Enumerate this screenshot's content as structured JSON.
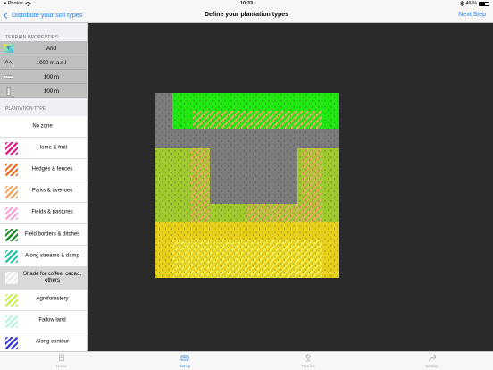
{
  "status": {
    "carrier": "Photos",
    "time": "10:33",
    "battery": "46 %"
  },
  "nav": {
    "back_label": "Distribute your soil types",
    "title": "Define your plantation types",
    "next_label": "Next Step"
  },
  "terrain": {
    "header": "TERRAIN PROPERTIES:",
    "rows": [
      {
        "icon": "soil-type-icon",
        "label": "Arid"
      },
      {
        "icon": "mountain-icon",
        "label": "1000 m.a.s.l"
      },
      {
        "icon": "width-ruler-icon",
        "label": "100 m"
      },
      {
        "icon": "height-ruler-icon",
        "label": "100 m"
      }
    ]
  },
  "plantation": {
    "header": "PLANTATION TYPE:",
    "items": [
      {
        "label": "No zone",
        "color": "",
        "selected": false
      },
      {
        "label": "Home & fruit",
        "color": "#e0228a",
        "selected": false
      },
      {
        "label": "Hedges & fences",
        "color": "#e8732e",
        "selected": false
      },
      {
        "label": "Parks & avenues",
        "color": "#f0a867",
        "selected": false
      },
      {
        "label": "Fields & pastures",
        "color": "#f7a3d6",
        "selected": false
      },
      {
        "label": "Field borders & ditches",
        "color": "#218c2e",
        "selected": false
      },
      {
        "label": "Along streams & damp",
        "color": "#28c9a8",
        "selected": false
      },
      {
        "label": "Shade for coffee, cacao, others",
        "color": "#ececec",
        "selected": true
      },
      {
        "label": "Agroforestery",
        "color": "#c8f05a",
        "selected": false
      },
      {
        "label": "Fallow land",
        "color": "#b6f5dd",
        "selected": false
      },
      {
        "label": "Along contour",
        "color": "#3f3fd0",
        "selected": false
      }
    ]
  },
  "map_colors": {
    "background": "#2a2a2a",
    "soil_gray": "#7c7c7c",
    "soil_green": "#22e812",
    "soil_olive": "#9fc92c",
    "soil_yellow": "#e8d01a",
    "hatch_orange": "#f0a867",
    "hatch_yellow": "#f0f050"
  },
  "tabs": [
    {
      "label": "Home",
      "icon": "home-icon",
      "active": false
    },
    {
      "label": "Set up",
      "icon": "setup-icon",
      "active": true
    },
    {
      "label": "Tree list",
      "icon": "tree-list-icon",
      "active": false
    },
    {
      "label": "Setting",
      "icon": "wrench-icon",
      "active": false
    }
  ]
}
